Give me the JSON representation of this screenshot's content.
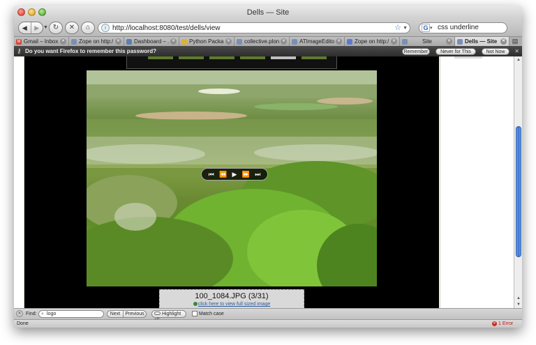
{
  "window": {
    "title": "Dells — Site"
  },
  "toolbar": {
    "back_icon": "back-arrow-icon",
    "forward_icon": "forward-arrow-icon",
    "reload_icon": "reload-icon",
    "stop_icon": "stop-icon",
    "home_icon": "home-icon",
    "url": "http://localhost:8080/test/dells/view",
    "search_value": "css underline"
  },
  "tabs": [
    {
      "label": "Gmail – Inbox ...",
      "favicon_color": "#d44638",
      "active": false
    },
    {
      "label": "Zope on http:/...",
      "favicon_color": "#7a8fb5",
      "active": false
    },
    {
      "label": "Dashboard – ...",
      "favicon_color": "#5d7fb1",
      "active": false
    },
    {
      "label": "Python Packa...",
      "favicon_color": "#d9b23a",
      "active": false
    },
    {
      "label": "collective.plon...",
      "favicon_color": "#7a8fb5",
      "active": false
    },
    {
      "label": "ATImageEdito...",
      "favicon_color": "#7a8fb5",
      "active": false
    },
    {
      "label": "Zope on http:/...",
      "favicon_color": "#5a7bd0",
      "active": false
    },
    {
      "label": "Site",
      "favicon_color": "#7a8fb5",
      "active": false
    },
    {
      "label": "Dells — Site",
      "favicon_color": "#7a8fb5",
      "active": true
    }
  ],
  "password_bar": {
    "message": "Do you want Firefox to remember this password?",
    "remember_label": "Remember",
    "never_label": "Never for This Site",
    "not_now_label": "Not Now"
  },
  "gallery": {
    "controls": [
      "⏮",
      "⏪",
      "▶",
      "⏩",
      "⏭"
    ],
    "caption_title": "100_1084.JPG (3/31)",
    "full_size_link": "click here to view full sized image"
  },
  "findbar": {
    "label": "Find:",
    "query": "logo",
    "next_label": "Next",
    "previous_label": "Previous",
    "highlight_label": "Highlight all",
    "match_case_label": "Match case"
  },
  "status": {
    "text": "Done",
    "errors": "1 Error"
  }
}
